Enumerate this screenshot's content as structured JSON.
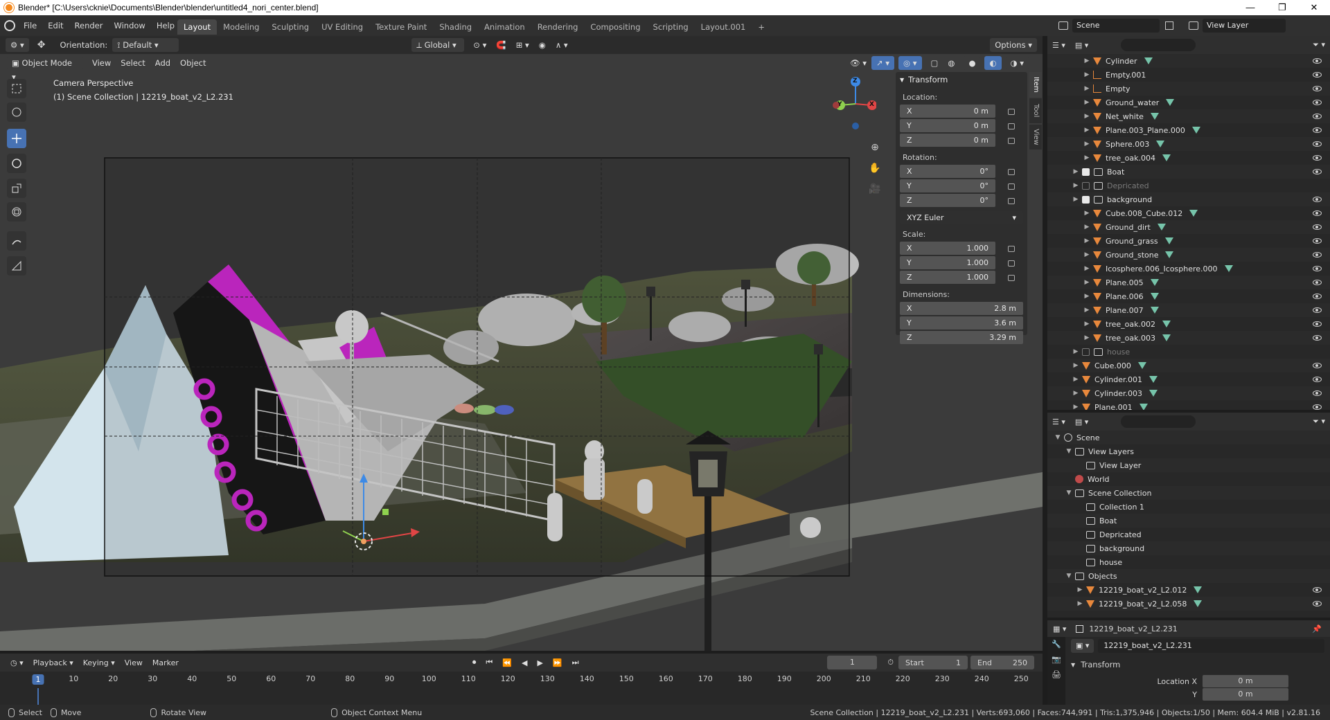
{
  "window": {
    "title": "Blender* [C:\\Users\\cknie\\Documents\\Blender\\blender\\untitled4_nori_center.blend]",
    "controls": [
      "—",
      "❐",
      "✕"
    ]
  },
  "menus": [
    "File",
    "Edit",
    "Render",
    "Window",
    "Help"
  ],
  "workspace_tabs": [
    "Layout",
    "Modeling",
    "Sculpting",
    "UV Editing",
    "Texture Paint",
    "Shading",
    "Animation",
    "Rendering",
    "Compositing",
    "Scripting",
    "Layout.001"
  ],
  "active_workspace": "Layout",
  "add_workspace": "+",
  "scene": {
    "name": "Scene",
    "view_layer": "View Layer"
  },
  "tool_header": {
    "orientation_label": "Orientation:",
    "orientation_value": "Default",
    "transform_orientation": "Global",
    "options_label": "Options"
  },
  "viewport_header": {
    "mode": "Object Mode",
    "menus": [
      "View",
      "Select",
      "Add",
      "Object"
    ]
  },
  "viewport": {
    "camera_text": "Camera Perspective",
    "collection_text": "(1) Scene Collection | 12219_boat_v2_L2.231",
    "gizmo_axes": [
      "X",
      "Y",
      "Z"
    ]
  },
  "side_tabs": [
    "Item",
    "Tool",
    "View"
  ],
  "npanel": {
    "title": "Transform",
    "location_label": "Location:",
    "location": [
      {
        "axis": "X",
        "value": "0 m"
      },
      {
        "axis": "Y",
        "value": "0 m"
      },
      {
        "axis": "Z",
        "value": "0 m"
      }
    ],
    "rotation_label": "Rotation:",
    "rotation": [
      {
        "axis": "X",
        "value": "0°"
      },
      {
        "axis": "Y",
        "value": "0°"
      },
      {
        "axis": "Z",
        "value": "0°"
      }
    ],
    "rotation_mode": "XYZ Euler",
    "scale_label": "Scale:",
    "scale": [
      {
        "axis": "X",
        "value": "1.000"
      },
      {
        "axis": "Y",
        "value": "1.000"
      },
      {
        "axis": "Z",
        "value": "1.000"
      }
    ],
    "dimensions_label": "Dimensions:",
    "dimensions": [
      {
        "axis": "X",
        "value": "2.8 m"
      },
      {
        "axis": "Y",
        "value": "3.6 m"
      },
      {
        "axis": "Z",
        "value": "3.29 m"
      }
    ]
  },
  "outliner": {
    "rows": [
      {
        "name": "Cylinder",
        "kind": "object",
        "indent": 2,
        "eye": true,
        "mesh": true
      },
      {
        "name": "Empty.001",
        "kind": "empty",
        "indent": 2,
        "eye": true,
        "mesh": false
      },
      {
        "name": "Empty",
        "kind": "empty",
        "indent": 2,
        "eye": true,
        "mesh": false
      },
      {
        "name": "Ground_water",
        "kind": "object",
        "indent": 2,
        "eye": true,
        "mesh": true
      },
      {
        "name": "Net_white",
        "kind": "object",
        "indent": 2,
        "eye": true,
        "mesh": true
      },
      {
        "name": "Plane.003_Plane.000",
        "kind": "object",
        "indent": 2,
        "eye": true,
        "mesh": true
      },
      {
        "name": "Sphere.003",
        "kind": "object",
        "indent": 2,
        "eye": true,
        "mesh": true
      },
      {
        "name": "tree_oak.004",
        "kind": "object",
        "indent": 2,
        "eye": true,
        "mesh": true
      },
      {
        "name": "Boat",
        "kind": "collection",
        "indent": 1,
        "eye": true,
        "mesh": false,
        "checked": true
      },
      {
        "name": "Depricated",
        "kind": "collection",
        "indent": 1,
        "eye": false,
        "mesh": false,
        "checked": false,
        "dim": true
      },
      {
        "name": "background",
        "kind": "collection",
        "indent": 1,
        "eye": true,
        "mesh": false,
        "checked": true
      },
      {
        "name": "Cube.008_Cube.012",
        "kind": "object",
        "indent": 2,
        "eye": true,
        "mesh": true
      },
      {
        "name": "Ground_dirt",
        "kind": "object",
        "indent": 2,
        "eye": true,
        "mesh": true
      },
      {
        "name": "Ground_grass",
        "kind": "object",
        "indent": 2,
        "eye": true,
        "mesh": true
      },
      {
        "name": "Ground_stone",
        "kind": "object",
        "indent": 2,
        "eye": true,
        "mesh": true
      },
      {
        "name": "Icosphere.006_Icosphere.000",
        "kind": "object",
        "indent": 2,
        "eye": true,
        "mesh": true
      },
      {
        "name": "Plane.005",
        "kind": "object",
        "indent": 2,
        "eye": true,
        "mesh": true
      },
      {
        "name": "Plane.006",
        "kind": "object",
        "indent": 2,
        "eye": true,
        "mesh": true
      },
      {
        "name": "Plane.007",
        "kind": "object",
        "indent": 2,
        "eye": true,
        "mesh": true
      },
      {
        "name": "tree_oak.002",
        "kind": "object",
        "indent": 2,
        "eye": true,
        "mesh": true
      },
      {
        "name": "tree_oak.003",
        "kind": "object",
        "indent": 2,
        "eye": true,
        "mesh": true
      },
      {
        "name": "house",
        "kind": "collection",
        "indent": 1,
        "eye": false,
        "mesh": false,
        "checked": false,
        "dim": true
      },
      {
        "name": "Cube.000",
        "kind": "object",
        "indent": 1,
        "eye": true,
        "mesh": true
      },
      {
        "name": "Cylinder.001",
        "kind": "object",
        "indent": 1,
        "eye": true,
        "mesh": true
      },
      {
        "name": "Cylinder.003",
        "kind": "object",
        "indent": 1,
        "eye": true,
        "mesh": true
      },
      {
        "name": "Plane.001",
        "kind": "object",
        "indent": 1,
        "eye": true,
        "mesh": true
      }
    ]
  },
  "outliner2": {
    "rows": [
      {
        "name": "Scene",
        "indent": 0,
        "kind": "scene",
        "eye": false
      },
      {
        "name": "View Layers",
        "indent": 1,
        "kind": "layers",
        "eye": false
      },
      {
        "name": "View Layer",
        "indent": 2,
        "kind": "layer",
        "eye": false
      },
      {
        "name": "World",
        "indent": 1,
        "kind": "world",
        "eye": false
      },
      {
        "name": "Scene Collection",
        "indent": 1,
        "kind": "collection",
        "eye": false
      },
      {
        "name": "Collection 1",
        "indent": 2,
        "kind": "collection",
        "eye": false
      },
      {
        "name": "Boat",
        "indent": 2,
        "kind": "collection",
        "eye": false
      },
      {
        "name": "Depricated",
        "indent": 2,
        "kind": "collection",
        "eye": false
      },
      {
        "name": "background",
        "indent": 2,
        "kind": "collection",
        "eye": false
      },
      {
        "name": "house",
        "indent": 2,
        "kind": "collection",
        "eye": false
      },
      {
        "name": "Objects",
        "indent": 1,
        "kind": "objects",
        "eye": false
      },
      {
        "name": "12219_boat_v2_L2.012",
        "indent": 2,
        "kind": "object",
        "eye": true
      },
      {
        "name": "12219_boat_v2_L2.058",
        "indent": 2,
        "kind": "object",
        "eye": true
      }
    ]
  },
  "properties": {
    "object_name": "12219_boat_v2_L2.231",
    "object_field": "12219_boat_v2_L2.231",
    "panel_title": "Transform",
    "location_x_label": "Location X",
    "location_x_value": "0 m",
    "location_y_label": "Y",
    "location_y_value": "0 m"
  },
  "timeline": {
    "menus": [
      "Playback",
      "Keying",
      "View",
      "Marker"
    ],
    "current_frame": "1",
    "start_label": "Start",
    "start_value": "1",
    "end_label": "End",
    "end_value": "250",
    "ruler": [
      "1",
      "10",
      "20",
      "30",
      "40",
      "50",
      "60",
      "70",
      "80",
      "90",
      "100",
      "110",
      "120",
      "130",
      "140",
      "150",
      "160",
      "170",
      "180",
      "190",
      "200",
      "210",
      "220",
      "230",
      "240",
      "250"
    ]
  },
  "statusbar": {
    "select": "Select",
    "move": "Move",
    "rotate": "Rotate View",
    "context": "Object Context Menu",
    "stats": "Scene Collection | 12219_boat_v2_L2.231 | Verts:693,060 | Faces:744,991 | Tris:1,375,946 | Objects:1/50 | Mem: 604.4 MiB | v2.81.16"
  },
  "colors": {
    "accent_blue": "#4772b3",
    "orange": "#e8883c",
    "boat_magenta": "#d42bd6",
    "mesh_teal": "#7ed5b8"
  }
}
